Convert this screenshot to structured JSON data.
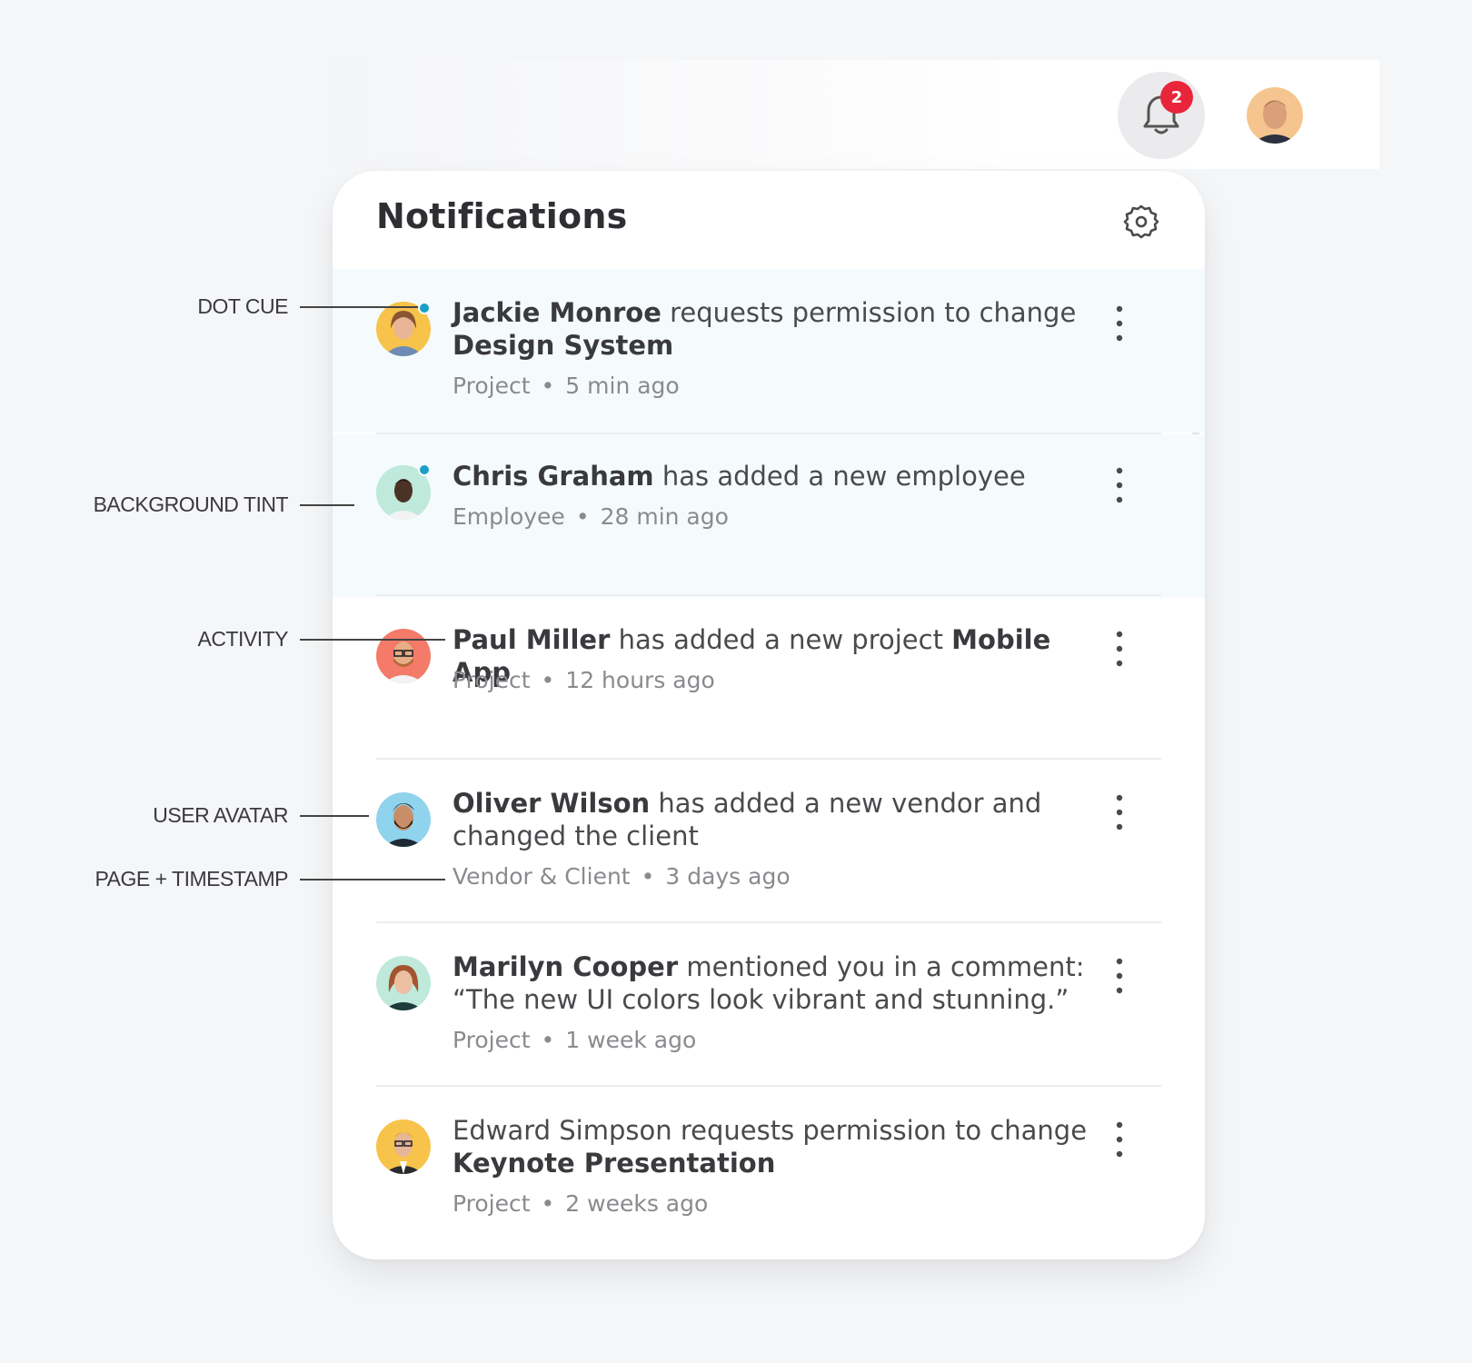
{
  "topbar": {
    "badge_count": "2"
  },
  "panel": {
    "title": "Notifications",
    "items": [
      {
        "name": "Jackie Monroe",
        "action": " requests permission to change ",
        "object": "Design System",
        "page": "Project",
        "time": "5 min ago",
        "unread": true,
        "avatar_color": "#f7c34a"
      },
      {
        "name": "Chris Graham",
        "action": " has added a new employee",
        "object": "",
        "page": "Employee",
        "time": "28 min ago",
        "unread": true,
        "avatar_color": "#bfe9da"
      },
      {
        "name": "Paul Miller",
        "action": " has added a new project ",
        "object": "Mobile App",
        "page": "Project",
        "time": "12 hours ago",
        "unread": false,
        "avatar_color": "#f47a6a"
      },
      {
        "name": "Oliver Wilson",
        "action": " has added a new vendor and changed the client",
        "object": "",
        "page": "Vendor & Client",
        "time": "3 days ago",
        "unread": false,
        "avatar_color": "#8fd3ec"
      },
      {
        "name": "Marilyn Cooper",
        "action": " mentioned you in a comment: “The new UI colors look vibrant and stunning.”",
        "object": "",
        "page": "Project",
        "time": "1 week ago",
        "unread": false,
        "avatar_color": "#bfe9da"
      },
      {
        "name": "",
        "action": "Edward Simpson requests permission to change ",
        "object": "Keynote Presentation",
        "page": "Project",
        "time": "2 weeks ago",
        "unread": false,
        "avatar_color": "#f7c34a"
      }
    ]
  },
  "annotations": {
    "dot_cue": "DOT CUE",
    "background_tint": "BACKGROUND TINT",
    "activity": "ACTIVITY",
    "user_avatar": "USER AVATAR",
    "page_timestamp": "PAGE + TIMESTAMP"
  },
  "colors": {
    "badge": "#e8253b",
    "dot": "#1a9fc6",
    "unread_tint": "#f5fbfc"
  },
  "icons": {
    "bell": "bell-icon",
    "settings": "gear-icon",
    "more": "kebab-menu-icon"
  }
}
